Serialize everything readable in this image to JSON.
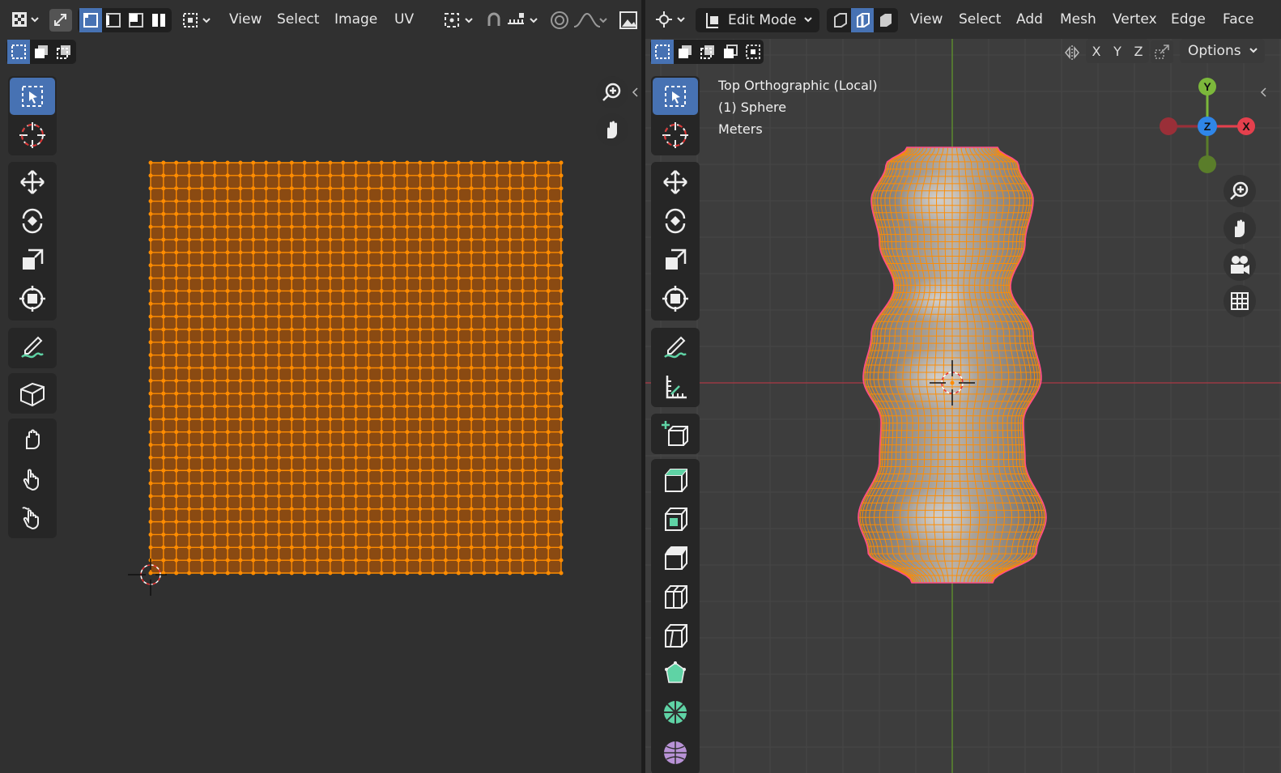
{
  "uv_editor": {
    "menu": {
      "view": "View",
      "select": "Select",
      "image": "Image",
      "uv": "UV"
    }
  },
  "viewport": {
    "mode_label": "Edit Mode",
    "menu": {
      "view": "View",
      "select": "Select",
      "add": "Add",
      "mesh": "Mesh",
      "vertex": "Vertex",
      "edge": "Edge",
      "face": "Face"
    },
    "axis_toggles": [
      "X",
      "Y",
      "Z"
    ],
    "options_label": "Options",
    "overlay_info": [
      "Top Orthographic (Local)",
      "(1) Sphere",
      "Meters"
    ],
    "gizmo": {
      "y": "Y",
      "z": "Z",
      "x": "X"
    }
  },
  "colors": {
    "selection": "#ff8c00",
    "accent": "#4772b3",
    "x_axis": "#e5404d",
    "y_axis": "#7cb83b",
    "z_axis": "#2f86e8"
  },
  "uv_grid": {
    "columns": 32,
    "rows": 32
  },
  "icons": [
    "select-box-icon",
    "cursor-icon",
    "move-icon",
    "rotate-icon",
    "scale-icon",
    "transform-icon",
    "annotate-icon",
    "measure-icon",
    "add-cube-icon",
    "extrude-icon",
    "inset-icon",
    "bevel-icon",
    "loop-cut-icon",
    "knife-icon",
    "poly-build-icon",
    "spin-icon",
    "smooth-icon",
    "grab-icon",
    "pinch-icon",
    "relax-icon",
    "zoom-icon",
    "hand-icon",
    "camera-icon",
    "grid-icon"
  ]
}
